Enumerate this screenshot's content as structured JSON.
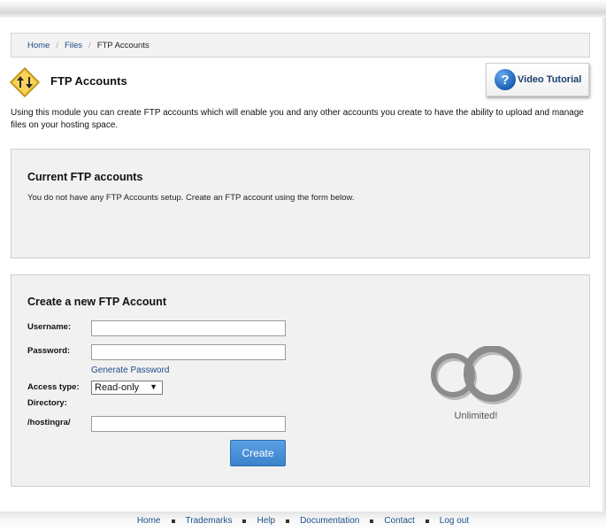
{
  "breadcrumb": {
    "home": "Home",
    "files": "Files",
    "current": "FTP Accounts"
  },
  "header": {
    "title": "FTP Accounts",
    "video_tutorial_label": "Video Tutorial",
    "video_icon_glyph": "?",
    "title_icon": "ftp-transfer-icon"
  },
  "intro_text": "Using this module you can create FTP accounts which will enable you and any other accounts you create to have the ability to upload and manage files on your hosting space.",
  "current_accounts": {
    "heading": "Current FTP accounts",
    "message": "You do not have any FTP Accounts setup. Create an FTP account using the form below."
  },
  "create_form": {
    "heading": "Create a new FTP Account",
    "username_label": "Username:",
    "username_value": "",
    "password_label": "Password:",
    "password_value": "",
    "generate_password_label": "Generate Password",
    "access_type_label": "Access type:",
    "access_type_value": "Read-only",
    "directory_label": "Directory:",
    "directory_prefix": "/hostingra/",
    "directory_value": "",
    "create_button_label": "Create",
    "unlimited_text": "Unlimited!"
  },
  "footer": {
    "links": [
      "Home",
      "Trademarks",
      "Help",
      "Documentation",
      "Contact",
      "Log out"
    ]
  },
  "colors": {
    "link": "#1d4e89",
    "button": "#3b82cc",
    "panel_bg": "#f1f1f1"
  }
}
